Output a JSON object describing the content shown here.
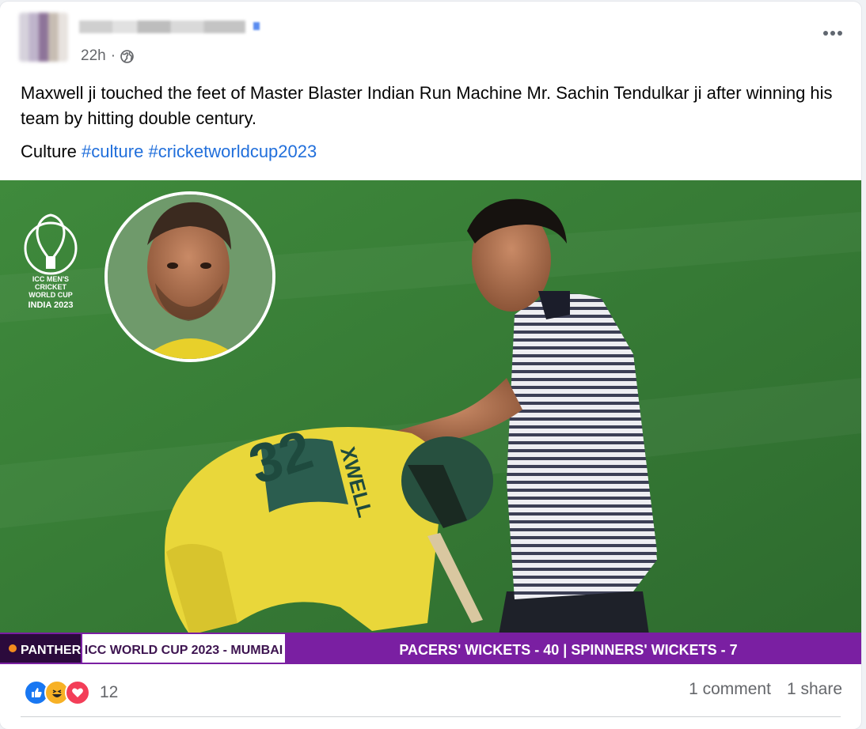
{
  "post": {
    "author_name": "",
    "timestamp": "22h",
    "separator": "·",
    "privacy_icon": "globe-icon",
    "text": "Maxwell ji touched the feet of Master Blaster Indian Run Machine  Mr. Sachin Tendulkar ji after winning his team by hitting double century.",
    "tag_prefix": "Culture",
    "hashtags": [
      "#culture",
      "#cricketworldcup2023"
    ]
  },
  "media": {
    "logo_lines": [
      "ICC MEN'S",
      "CRICKET",
      "WORLD CUP",
      "INDIA 2023"
    ],
    "jersey_text": "XWELL",
    "jersey_number": "32",
    "ticker": {
      "sponsor": "PANTHER",
      "title": "ICC WORLD CUP 2023 - MUMBAI",
      "stat": "PACERS' WICKETS - 40 | SPINNERS' WICKETS - 7"
    }
  },
  "footer": {
    "reaction_icons": [
      "like-icon",
      "haha-icon",
      "love-icon"
    ],
    "reaction_count": "12",
    "comments": "1 comment",
    "shares": "1 share"
  },
  "colors": {
    "hashtag": "#216fdb",
    "like": "#1877f2",
    "love": "#f33e58",
    "haha": "#f7b125",
    "ticker_purple": "#7a1fa2"
  }
}
